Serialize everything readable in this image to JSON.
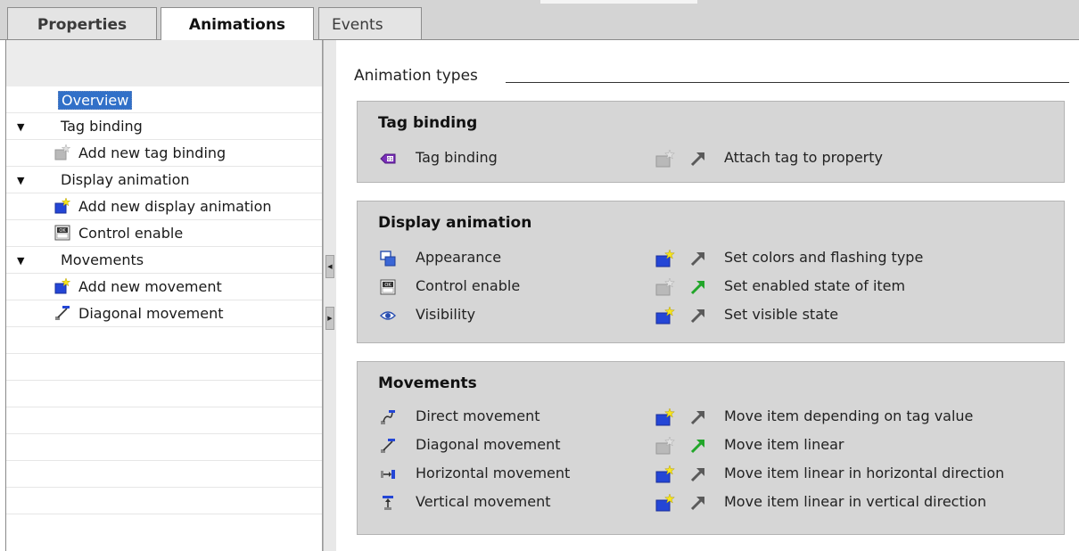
{
  "tabs": [
    {
      "label": "Properties"
    },
    {
      "label": "Animations"
    },
    {
      "label": "Events"
    }
  ],
  "nav": {
    "overview": "Overview",
    "items": [
      {
        "label": "Tag binding",
        "icon": "caret-down-icon"
      },
      {
        "label": "Add new tag binding",
        "icon": "add-new-disabled-icon"
      },
      {
        "label": "Display animation",
        "icon": "caret-down-icon"
      },
      {
        "label": "Add new display animation",
        "icon": "add-new-icon"
      },
      {
        "label": "Control enable",
        "icon": "control-enable-icon"
      },
      {
        "label": "Movements",
        "icon": "caret-down-icon"
      },
      {
        "label": "Add new movement",
        "icon": "add-new-icon"
      },
      {
        "label": "Diagonal movement",
        "icon": "diagonal-movement-icon"
      }
    ]
  },
  "content": {
    "section_title": "Animation types",
    "groups": [
      {
        "title": "Tag binding",
        "rows": [
          {
            "name": "Tag binding",
            "desc": "Attach tag to property",
            "icon": "tag-icon",
            "add_enabled": false,
            "active": false
          }
        ]
      },
      {
        "title": "Display animation",
        "rows": [
          {
            "name": "Appearance",
            "desc": "Set colors and flashing type",
            "icon": "appearance-icon",
            "add_enabled": true,
            "active": false
          },
          {
            "name": "Control enable",
            "desc": "Set enabled state of item",
            "icon": "control-enable-icon",
            "add_enabled": false,
            "active": true
          },
          {
            "name": "Visibility",
            "desc": "Set visible state",
            "icon": "eye-icon",
            "add_enabled": true,
            "active": false
          }
        ]
      },
      {
        "title": "Movements",
        "rows": [
          {
            "name": "Direct movement",
            "desc": "Move item depending on tag value",
            "icon": "direct-movement-icon",
            "add_enabled": true,
            "active": false
          },
          {
            "name": "Diagonal movement",
            "desc": "Move item linear",
            "icon": "diagonal-movement-icon",
            "add_enabled": false,
            "active": true
          },
          {
            "name": "Horizontal movement",
            "desc": "Move item linear in horizontal direction",
            "icon": "horizontal-movement-icon",
            "add_enabled": true,
            "active": false
          },
          {
            "name": "Vertical movement",
            "desc": "Move item linear in vertical direction",
            "icon": "vertical-movement-icon",
            "add_enabled": true,
            "active": false
          }
        ]
      }
    ]
  },
  "colors": {
    "selection": "#3170c8",
    "group_bg": "#d6d6d6",
    "arrow_active": "#22a62a",
    "arrow_inactive": "#5a5a5a"
  }
}
